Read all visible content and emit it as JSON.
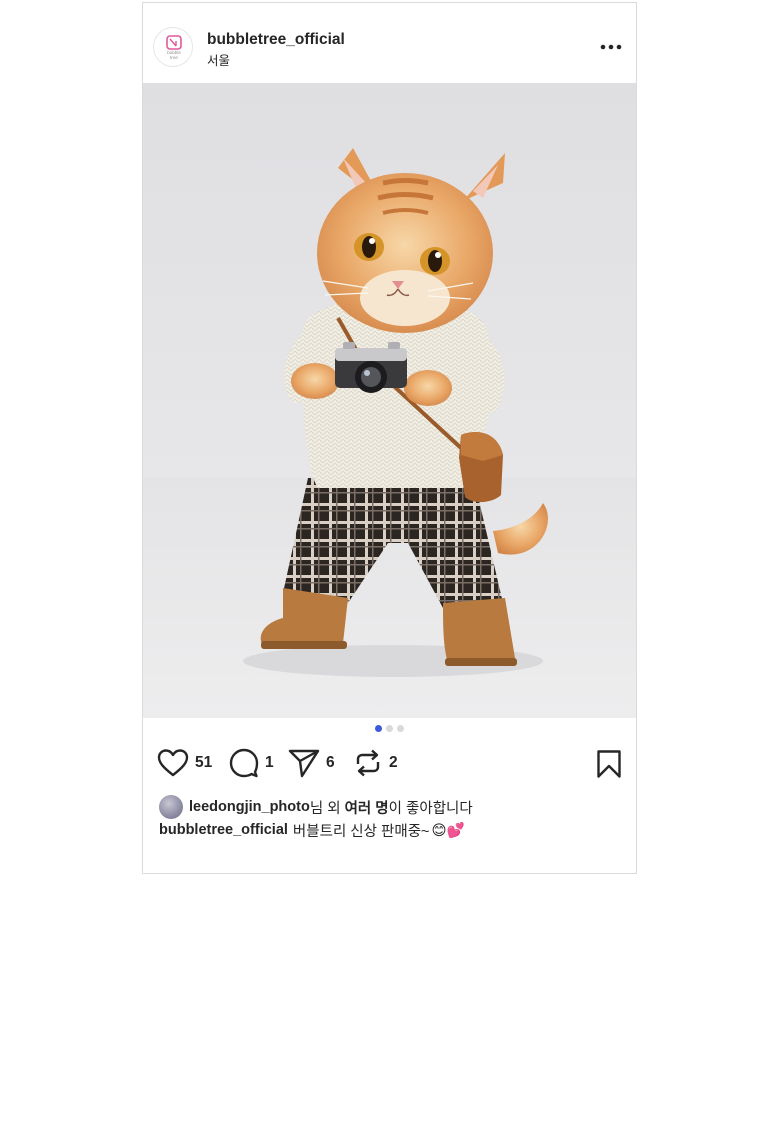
{
  "post": {
    "username": "bubbletree_official",
    "location": "서울",
    "avatar_logo_text": "bubble tree",
    "carousel": {
      "total": 3,
      "active": 1
    },
    "actions": {
      "likes": "51",
      "comments": "1",
      "shares": "6",
      "reposts": "2"
    },
    "liked_by": {
      "user": "leedongjin_photo",
      "suffix_1": "님 외 ",
      "others": "여러 명",
      "suffix_2": "이 좋아합니다"
    },
    "caption": {
      "user": "bubbletree_official",
      "text": "버블트리 신상 판매중~",
      "emojis": "😊💕"
    }
  },
  "colors": {
    "accent": "#3b5bdb",
    "logo_pink": "#e0589a",
    "text": "#262626",
    "border": "#dbdbdb"
  },
  "icons": [
    "more-icon",
    "heart-icon",
    "comment-icon",
    "share-icon",
    "repost-icon",
    "bookmark-icon"
  ]
}
